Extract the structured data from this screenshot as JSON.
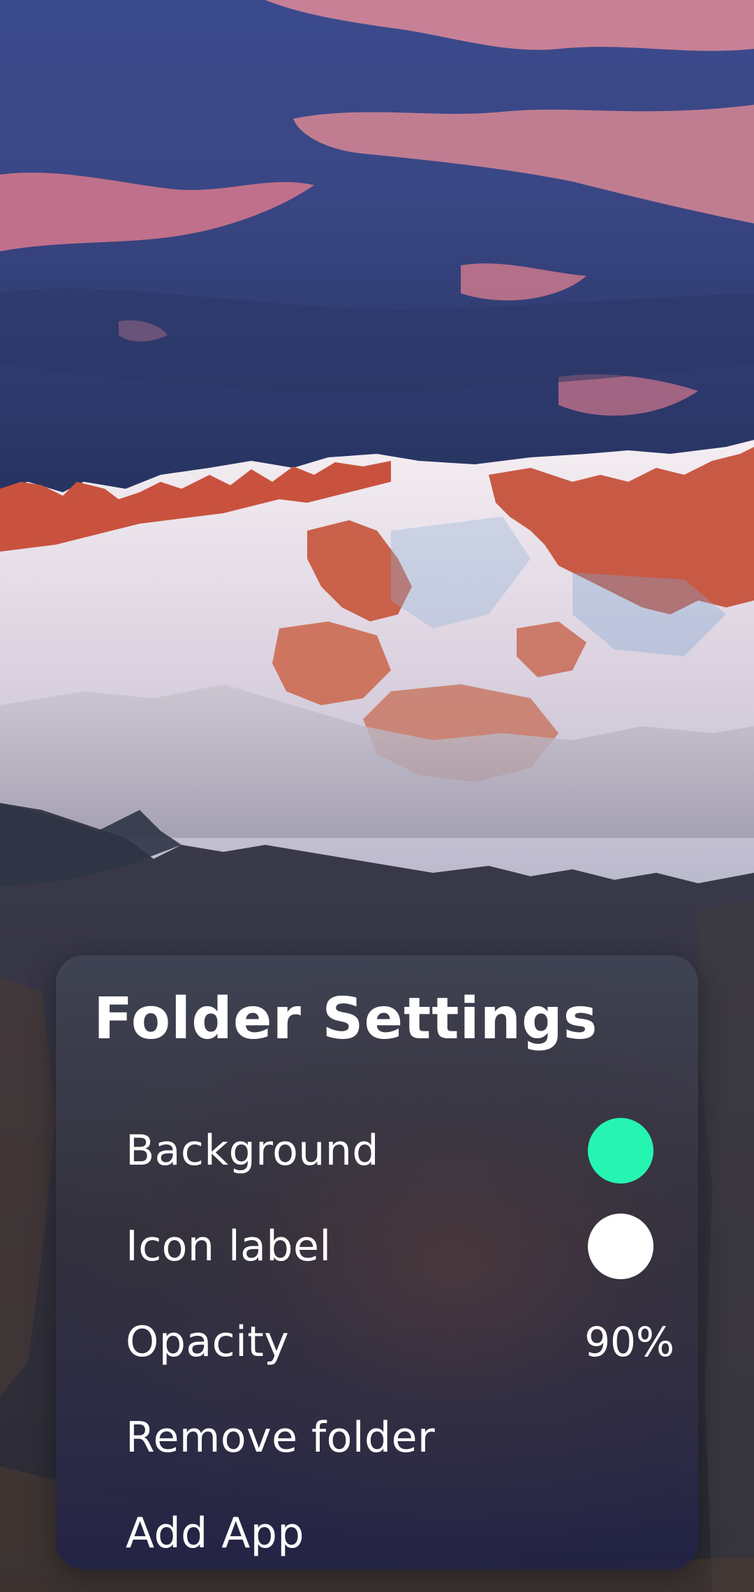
{
  "panel": {
    "title": "Folder Settings",
    "rows": [
      {
        "label": "Background",
        "swatch_color": "#26F5B2"
      },
      {
        "label": "Icon label",
        "swatch_color": "#FFFFFF"
      },
      {
        "label": "Opacity",
        "value": "90%"
      },
      {
        "label": "Remove folder"
      },
      {
        "label": "Add App"
      }
    ]
  },
  "wallpaper": {
    "description_icon": "mountain-wallpaper"
  }
}
